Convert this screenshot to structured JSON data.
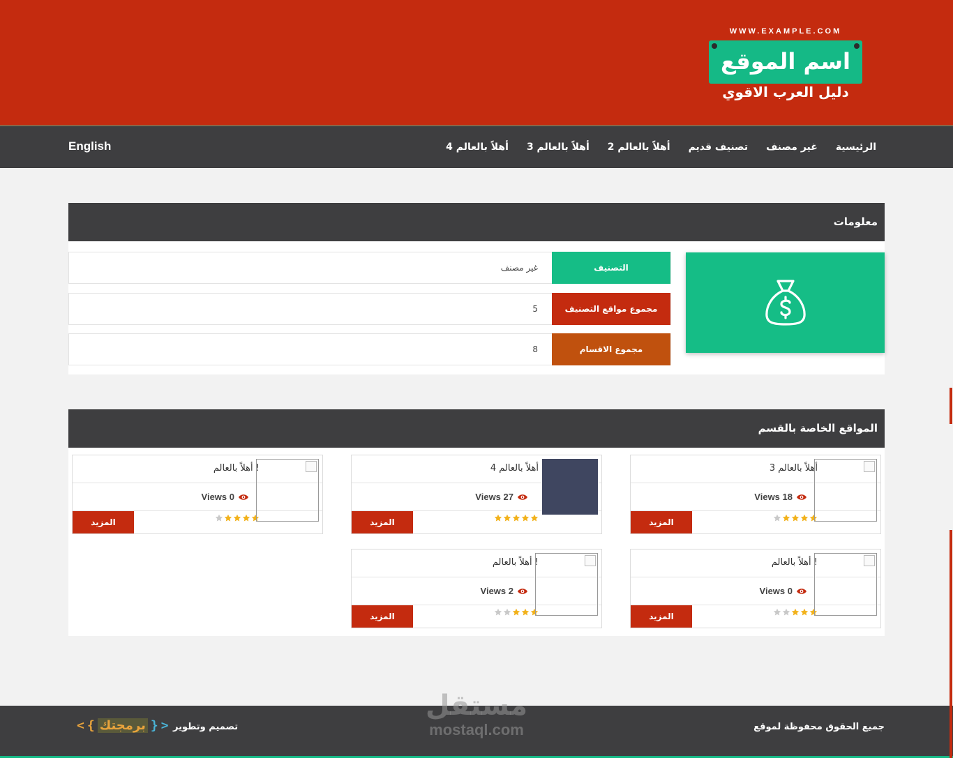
{
  "header": {
    "logo_url": "WWW.EXAMPLE.COM",
    "logo_title": "اسم الموقع",
    "logo_tagline": "دليل العرب الاقوي",
    "bg_color": "#c42b0f",
    "logo_color": "#15b986"
  },
  "nav": {
    "lang": "English",
    "items": [
      {
        "label": "الرئيسية"
      },
      {
        "label": "غير مصنف"
      },
      {
        "label": "تصنيف قديم"
      },
      {
        "label": "أهلاً بالعالم 2"
      },
      {
        "label": "أهلاً بالعالم 3"
      },
      {
        "label": "أهلاً بالعالم 4"
      }
    ]
  },
  "info": {
    "title": "معلومات",
    "icon": "money-bag-icon",
    "rows": [
      {
        "label": "التصنيف",
        "value": "غير مصنف",
        "color": "#15bd86"
      },
      {
        "label": "مجموع مواقع التصنيف",
        "value": "5",
        "color": "#c42b0f"
      },
      {
        "label": "مجموع الاقسام",
        "value": "8",
        "color": "#c0510e"
      }
    ]
  },
  "sites": {
    "title": "المواقع الخاصة بالقسم",
    "more_label": "المزيد",
    "cards": [
      {
        "title": "أهلاً بالعالم 3",
        "views": "Views 18",
        "rating": 4
      },
      {
        "title": "أهلاً بالعالم 4",
        "views": "Views 27",
        "rating": 5
      },
      {
        "title": "أهلاً بالعالم !",
        "views": "Views 0",
        "rating": 4
      },
      {
        "title": "أهلاً بالعالم !",
        "views": "Views 0",
        "rating": 3
      },
      {
        "title": "أهلاً بالعالم !",
        "views": "Views 2",
        "rating": 3
      }
    ]
  },
  "footer": {
    "copyright": "جميع الحقوق محفوظة لموقع",
    "design": "تصميم وتطوير",
    "brand_open": "<",
    "brand_brace_open": "{",
    "brand_name": "برمجتك",
    "brand_brace_close": "}",
    "brand_close": ">"
  },
  "watermark": {
    "ar": "مستقل",
    "en": "mostaql.com"
  }
}
